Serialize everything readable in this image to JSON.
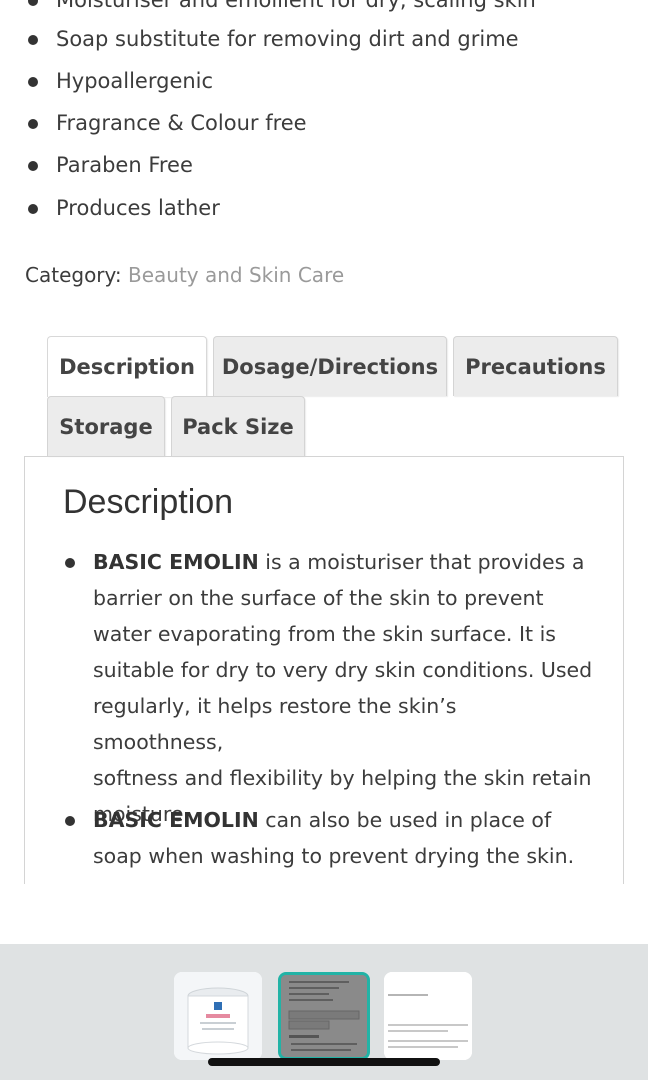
{
  "features": [
    "Moisturiser and emollient for dry, scaling skin",
    "Soap substitute for removing dirt and grime",
    "Hypoallergenic",
    "Fragrance & Colour free",
    "Paraben Free",
    "Produces lather"
  ],
  "category": {
    "label": "Category:",
    "value": "Beauty and Skin Care"
  },
  "tabs": [
    {
      "label": "Description",
      "active": true
    },
    {
      "label": "Dosage/Directions"
    },
    {
      "label": "Precautions"
    },
    {
      "label": "Storage"
    },
    {
      "label": "Pack Size"
    }
  ],
  "panel": {
    "title": "Description",
    "items": [
      {
        "bold": "BASIC EMOLIN",
        "lines": [
          " is a moisturiser that provides a",
          "barrier on the surface of the skin to prevent",
          "water evaporating from the skin surface. It is",
          "suitable for dry to very dry skin conditions. Used",
          "regularly, it helps restore the skin’s smoothness,",
          "softness and flexibility by helping the skin retain",
          "moisture."
        ]
      },
      {
        "bold": "BASIC EMOLIN",
        "lines": [
          " can also be used in place of",
          "soap when washing to prevent drying the skin."
        ]
      }
    ]
  },
  "thumbnails": [
    {
      "name": "product-jar",
      "selected": false
    },
    {
      "name": "description-page",
      "selected": true
    },
    {
      "name": "product-info-page",
      "selected": false
    }
  ],
  "colors": {
    "selected_border": "#22b3a6",
    "tab_bg": "#ececec"
  }
}
